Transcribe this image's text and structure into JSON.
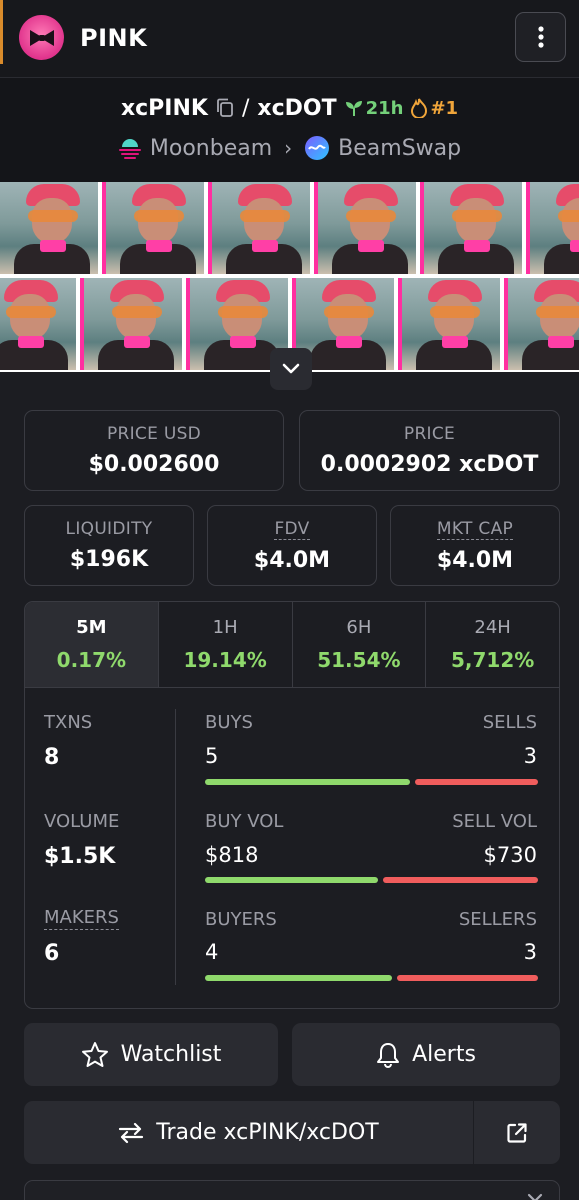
{
  "header": {
    "title": "PINK",
    "logo_icon": "bow-logo-icon",
    "menu_icon": "kebab-menu-icon"
  },
  "pair": {
    "base": "xcPINK",
    "separator": "/",
    "quote": "xcDOT",
    "age": "21h",
    "rank": "#1",
    "chain": "Moonbeam",
    "dex": "BeamSwap"
  },
  "prices": {
    "price_usd_label": "PRICE USD",
    "price_usd": "$0.002600",
    "price_label": "PRICE",
    "price": "0.0002902 xcDOT"
  },
  "metrics": {
    "liquidity_label": "LIQUIDITY",
    "liquidity": "$196K",
    "fdv_label": "FDV",
    "fdv": "$4.0M",
    "mktcap_label": "MKT CAP",
    "mktcap": "$4.0M"
  },
  "tabs": [
    {
      "label": "5M",
      "value": "0.17%"
    },
    {
      "label": "1H",
      "value": "19.14%"
    },
    {
      "label": "6H",
      "value": "51.54%"
    },
    {
      "label": "24H",
      "value": "5,712%"
    }
  ],
  "stats": {
    "txns_label": "TXNS",
    "txns": "8",
    "volume_label": "VOLUME",
    "volume": "$1.5K",
    "makers_label": "MAKERS",
    "makers": "6",
    "buys_label": "BUYS",
    "buys": "5",
    "sells_label": "SELLS",
    "sells": "3",
    "buy_vol_label": "BUY VOL",
    "buy_vol": "$818",
    "sell_vol_label": "SELL VOL",
    "sell_vol": "$730",
    "buyers_label": "BUYERS",
    "buyers": "4",
    "sellers_label": "SELLERS",
    "sellers": "3",
    "buys_ratio": 0.625,
    "buy_vol_ratio": 0.528,
    "buyers_ratio": 0.571
  },
  "actions": {
    "watchlist": "Watchlist",
    "alerts": "Alerts",
    "trade": "Trade xcPINK/xcDOT"
  },
  "colors": {
    "positive": "#8fd96c",
    "negative": "#f05d5d",
    "accent_pink": "#ff2fa0"
  }
}
